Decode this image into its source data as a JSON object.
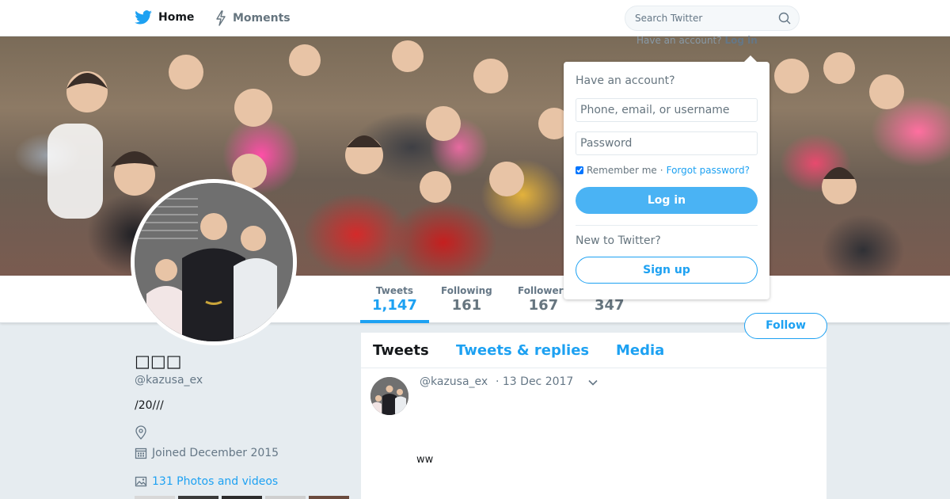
{
  "nav": {
    "home_label": "Home",
    "moments_label": "Moments",
    "search_placeholder": "Search Twitter",
    "login_hint_text": "Have an account?",
    "login_hint_link": "Log in"
  },
  "profile": {
    "name": "□□□",
    "handle": "@kazusa_ex",
    "bio": "/20///",
    "joined": "Joined December 2015",
    "media_link": "131 Photos and videos"
  },
  "stats": [
    {
      "label": "Tweets",
      "value": "1,147"
    },
    {
      "label": "Following",
      "value": "161"
    },
    {
      "label": "Followers",
      "value": "167"
    },
    {
      "label": "",
      "value": "347"
    }
  ],
  "follow_label": "Follow",
  "timeline": {
    "tabs": [
      "Tweets",
      "Tweets & replies",
      "Media"
    ],
    "tweet": {
      "handle": "@kazusa_ex",
      "date": "· 13 Dec 2017",
      "text": "ww"
    }
  },
  "login": {
    "title": "Have an account?",
    "username_placeholder": "Phone, email, or username",
    "password_placeholder": "Password",
    "remember": "Remember me",
    "separator": "·",
    "forgot": "Forgot password?",
    "login_button": "Log in",
    "new_to": "New to Twitter?",
    "signup_button": "Sign up"
  },
  "colors": {
    "accent": "#1da1f2",
    "login_button": "#4ab3f4",
    "background": "#e6ecf0"
  }
}
